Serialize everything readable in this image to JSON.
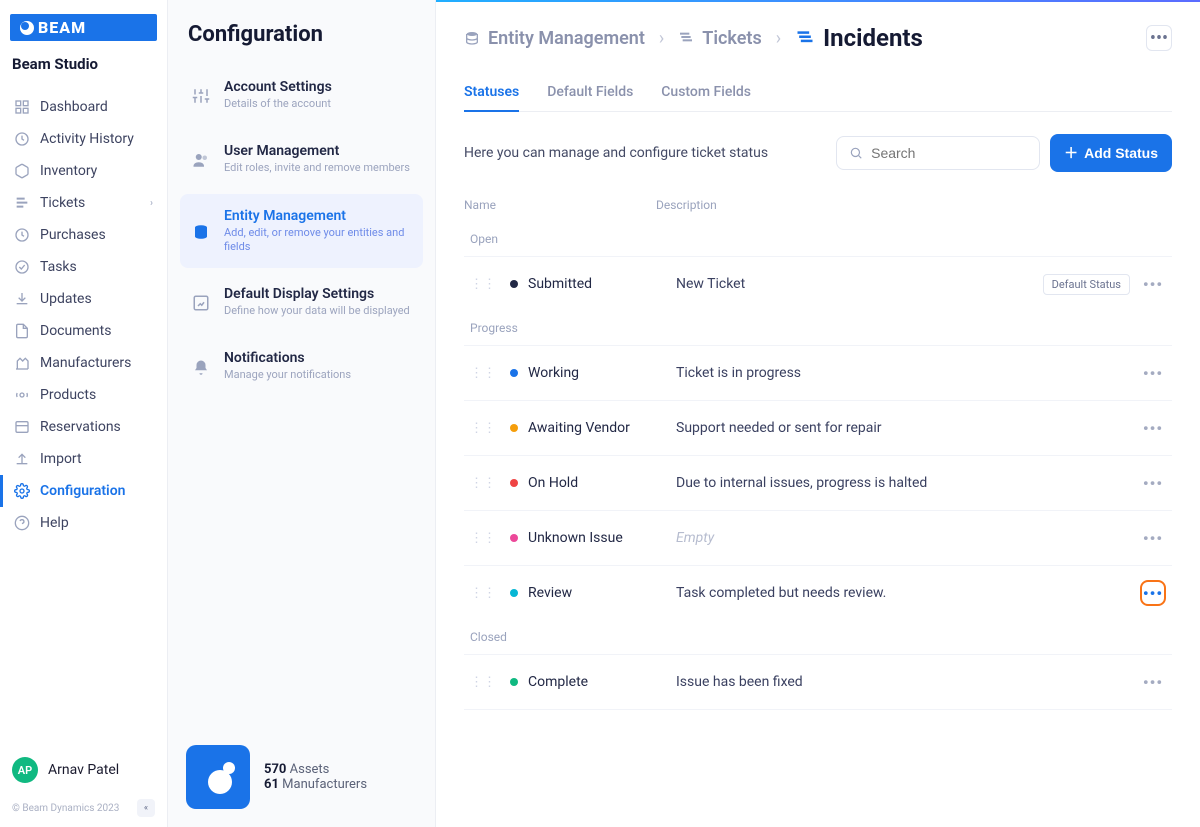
{
  "app": {
    "brand": "BEAM",
    "studio": "Beam Studio",
    "copyright": "© Beam Dynamics 2023"
  },
  "nav": [
    {
      "label": "Dashboard"
    },
    {
      "label": "Activity History"
    },
    {
      "label": "Inventory"
    },
    {
      "label": "Tickets",
      "expandable": true
    },
    {
      "label": "Purchases"
    },
    {
      "label": "Tasks"
    },
    {
      "label": "Updates"
    },
    {
      "label": "Documents"
    },
    {
      "label": "Manufacturers"
    },
    {
      "label": "Products"
    },
    {
      "label": "Reservations"
    },
    {
      "label": "Import"
    }
  ],
  "nav_bottom": [
    {
      "label": "Configuration",
      "active": true
    },
    {
      "label": "Help"
    }
  ],
  "user": {
    "initials": "AP",
    "name": "Arnav Patel"
  },
  "config": {
    "title": "Configuration",
    "items": [
      {
        "title": "Account Settings",
        "desc": "Details of the account"
      },
      {
        "title": "User Management",
        "desc": "Edit roles, invite and remove members"
      },
      {
        "title": "Entity Management",
        "desc": "Add, edit, or remove your entities and fields",
        "active": true
      },
      {
        "title": "Default Display Settings",
        "desc": "Define how your data will be displayed"
      },
      {
        "title": "Notifications",
        "desc": "Manage your notifications"
      }
    ],
    "stats": {
      "assets_n": "570",
      "assets_l": "Assets",
      "mfr_n": "61",
      "mfr_l": "Manufacturers"
    }
  },
  "breadcrumb": [
    {
      "label": "Entity Management"
    },
    {
      "label": "Tickets"
    },
    {
      "label": "Incidents",
      "active": true
    }
  ],
  "tabs": [
    {
      "label": "Statuses",
      "active": true
    },
    {
      "label": "Default Fields"
    },
    {
      "label": "Custom Fields"
    }
  ],
  "toolbar": {
    "hint": "Here you can manage and configure ticket status",
    "search_placeholder": "Search",
    "add_label": "Add Status"
  },
  "table": {
    "col_name": "Name",
    "col_desc": "Description",
    "badge_default": "Default Status",
    "groups": [
      {
        "label": "Open",
        "rows": [
          {
            "name": "Submitted",
            "desc": "New Ticket",
            "color": "#222845",
            "default": true
          }
        ]
      },
      {
        "label": "Progress",
        "rows": [
          {
            "name": "Working",
            "desc": "Ticket is in progress",
            "color": "#1a73e8"
          },
          {
            "name": "Awaiting Vendor",
            "desc": "Support needed or sent for repair",
            "color": "#f59e0b"
          },
          {
            "name": "On Hold",
            "desc": "Due to internal issues, progress is halted",
            "color": "#ef4444"
          },
          {
            "name": "Unknown Issue",
            "desc": "Empty",
            "empty": true,
            "color": "#ec4899"
          },
          {
            "name": "Review",
            "desc": "Task completed but needs review.",
            "color": "#06b6d4",
            "highlight": true
          }
        ]
      },
      {
        "label": "Closed",
        "rows": [
          {
            "name": "Complete",
            "desc": "Issue has been fixed",
            "color": "#10b981"
          }
        ]
      }
    ]
  }
}
